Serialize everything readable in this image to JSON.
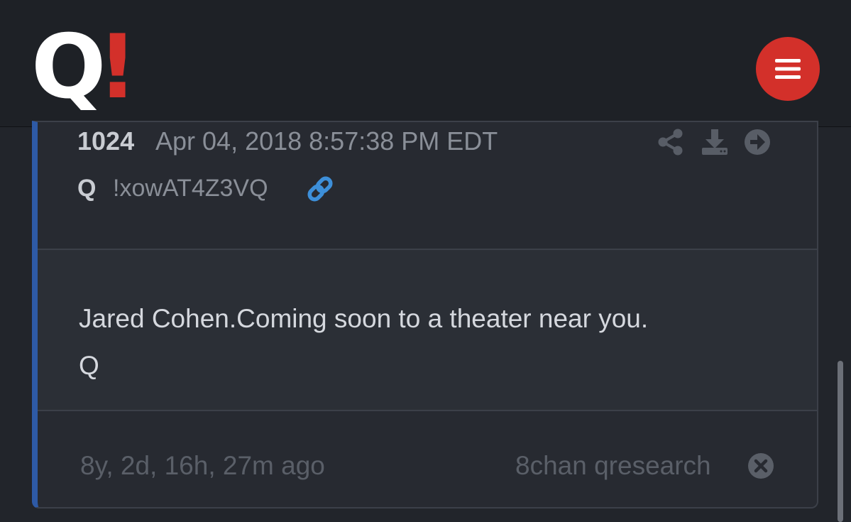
{
  "header": {
    "logo_q": "Q",
    "logo_bang": "!",
    "menu_icon": "hamburger-menu-icon",
    "accent_color": "#d3302a"
  },
  "post": {
    "number": "1024",
    "date": "Apr 04, 2018 8:57:38 PM EDT",
    "author": "Q",
    "tripcode": "!xowAT4Z3VQ",
    "icons": [
      "share-icon",
      "download-icon",
      "arrow-right-circle-icon",
      "link-icon"
    ],
    "body_lines": [
      "Jared Cohen.Coming soon to a theater near you.",
      "Q"
    ],
    "elapsed": "8y, 2d, 16h, 27m ago",
    "source": "8chan qresearch",
    "link_color": "#3d8fd9",
    "border_accent": "#2e5aa6"
  }
}
